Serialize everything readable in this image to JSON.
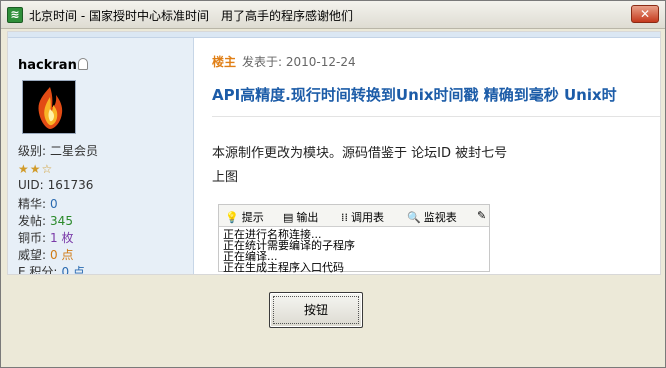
{
  "window": {
    "title": "北京时间 - 国家授时中心标准时间　用了高手的程序感谢他们",
    "app_icon_glyph": "≋",
    "close_glyph": "✕"
  },
  "user": {
    "name": "hackran",
    "avatar": "fire-emblem",
    "level_label": "级别:",
    "level_value": "二星会员",
    "stars": "★★☆",
    "uid_label": "UID:",
    "uid_value": "161736",
    "jinghua_label": "精华:",
    "jinghua_value": "0",
    "posts_label": "发帖:",
    "posts_value": "345",
    "coins_label": "铜币:",
    "coins_value": "1 枚",
    "prestige_label": "威望:",
    "prestige_value": "0 点",
    "eccredit_label": "E 积分:",
    "eccredit_value": "0 点"
  },
  "post": {
    "owner_label": "楼主",
    "posted_on": "发表于: 2010-12-24",
    "title": "API高精度.现行时间转换到Unix时间戳 精确到毫秒 Unix时",
    "line1": "本源制作更改为模块。源码借鉴于 论坛ID 被封七号",
    "line2": "上图"
  },
  "embedded_window": {
    "toolbar": [
      {
        "icon": "💡",
        "label": "提示"
      },
      {
        "icon": "▤",
        "label": "输出"
      },
      {
        "icon": "⁞⁞",
        "label": "调用表"
      },
      {
        "icon": "🔍",
        "label": "监视表"
      },
      {
        "icon": "✎",
        "label": ""
      }
    ],
    "log": [
      "正在进行名称连接...",
      "正在统计需要编译的子程序",
      "正在编译...",
      "正在生成主程序入口代码"
    ]
  },
  "button": {
    "label": "按钮"
  },
  "colors": {
    "title_blue": "#1c5ca8",
    "owner_orange": "#e07f16",
    "posts_green": "#2a8a2a",
    "coins_purple": "#7a3aa8",
    "prestige_orange": "#d07a14",
    "eccredit_blue": "#2a6ab0"
  }
}
